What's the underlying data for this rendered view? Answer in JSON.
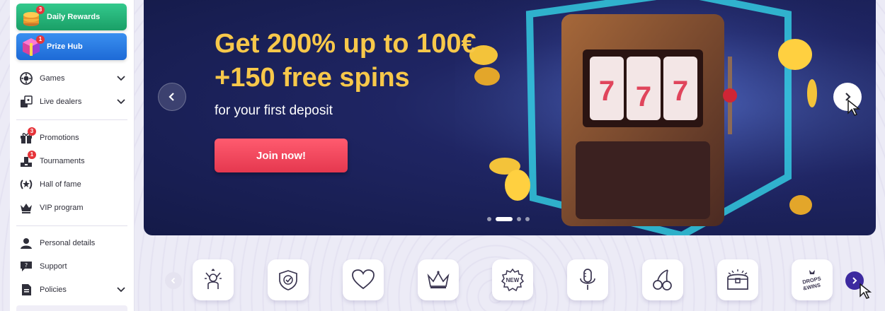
{
  "sidebar": {
    "daily_rewards": {
      "label": "Daily Rewards",
      "badge": "3"
    },
    "prize_hub": {
      "label": "Prize Hub",
      "badge": "1"
    },
    "nav": [
      {
        "label": "Games",
        "icon": "games-icon",
        "has_chevron": true
      },
      {
        "label": "Live dealers",
        "icon": "live-dealers-icon",
        "has_chevron": true
      },
      {
        "label": "Promotions",
        "icon": "gift-icon",
        "badge": "3"
      },
      {
        "label": "Tournaments",
        "icon": "trophy-icon",
        "badge": "1"
      },
      {
        "label": "Hall of fame",
        "icon": "laurel-icon"
      },
      {
        "label": "VIP program",
        "icon": "crown-icon"
      },
      {
        "label": "Personal details",
        "icon": "user-icon"
      },
      {
        "label": "Support",
        "icon": "chat-icon"
      },
      {
        "label": "Policies",
        "icon": "document-icon",
        "has_chevron": true
      }
    ]
  },
  "banner": {
    "title_line1": "Get 200% up to 100€",
    "title_line2": "+150 free spins",
    "subtitle": "for your first deposit",
    "cta": "Join now!",
    "slide_count": 4,
    "active_slide": 2
  },
  "categories": [
    {
      "icon": "celebrating-player-icon"
    },
    {
      "icon": "shield-check-icon"
    },
    {
      "icon": "heart-icon"
    },
    {
      "icon": "crown-icon"
    },
    {
      "icon": "new-badge-icon",
      "text": "NEW"
    },
    {
      "icon": "microphone-icon"
    },
    {
      "icon": "cherries-icon"
    },
    {
      "icon": "treasure-chest-icon"
    },
    {
      "icon": "drops-and-wins-icon",
      "text": "DROPS & WINS"
    }
  ],
  "colors": {
    "accent_gold": "#f7c84a",
    "cta_red": "#e5384f",
    "rewards_green": "#1a9f67",
    "prize_blue": "#1d6ad6",
    "badge_red": "#e6343a",
    "strip_next_purple": "#3d2aa0"
  }
}
